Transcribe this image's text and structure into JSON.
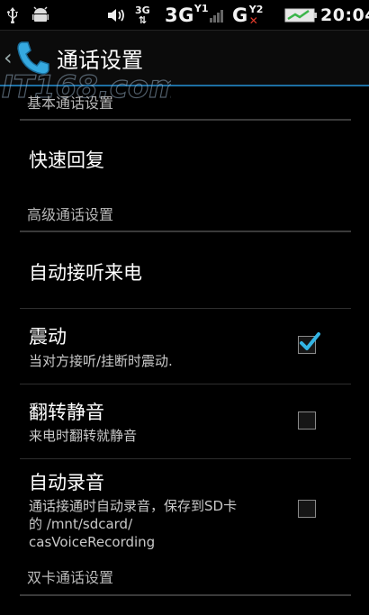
{
  "status_bar": {
    "network_3g_badge": "3G",
    "network_3g": "3G",
    "network_3g_sup": "Y1",
    "network_g": "G",
    "network_g_sup": "Y2",
    "time": "20:04"
  },
  "title_bar": {
    "title": "通话设置"
  },
  "watermark": {
    "text": "IT168.com"
  },
  "sections": {
    "basic_header": "基本通话设置",
    "advanced_header": "高级通话设置",
    "dual_header": "双卡通话设置"
  },
  "prefs": {
    "quick_reply": {
      "title": "快速回复"
    },
    "auto_answer": {
      "title": "自动接听来电"
    },
    "vibrate": {
      "title": "震动",
      "summary": "当对方接听/挂断时震动.",
      "checked": true
    },
    "flip_mute": {
      "title": "翻转静音",
      "summary": "来电时翻转就静音",
      "checked": false
    },
    "auto_record": {
      "title": "自动录音",
      "summary_line1": "通话接通时自动录音，保存到SD卡",
      "summary_line2": "的 /mnt/sdcard/",
      "summary_line3": "casVoiceRecording",
      "checked": false
    }
  },
  "colors": {
    "accent": "#33b5e5",
    "title_underline": "#1d6fa3",
    "background": "#000000"
  }
}
